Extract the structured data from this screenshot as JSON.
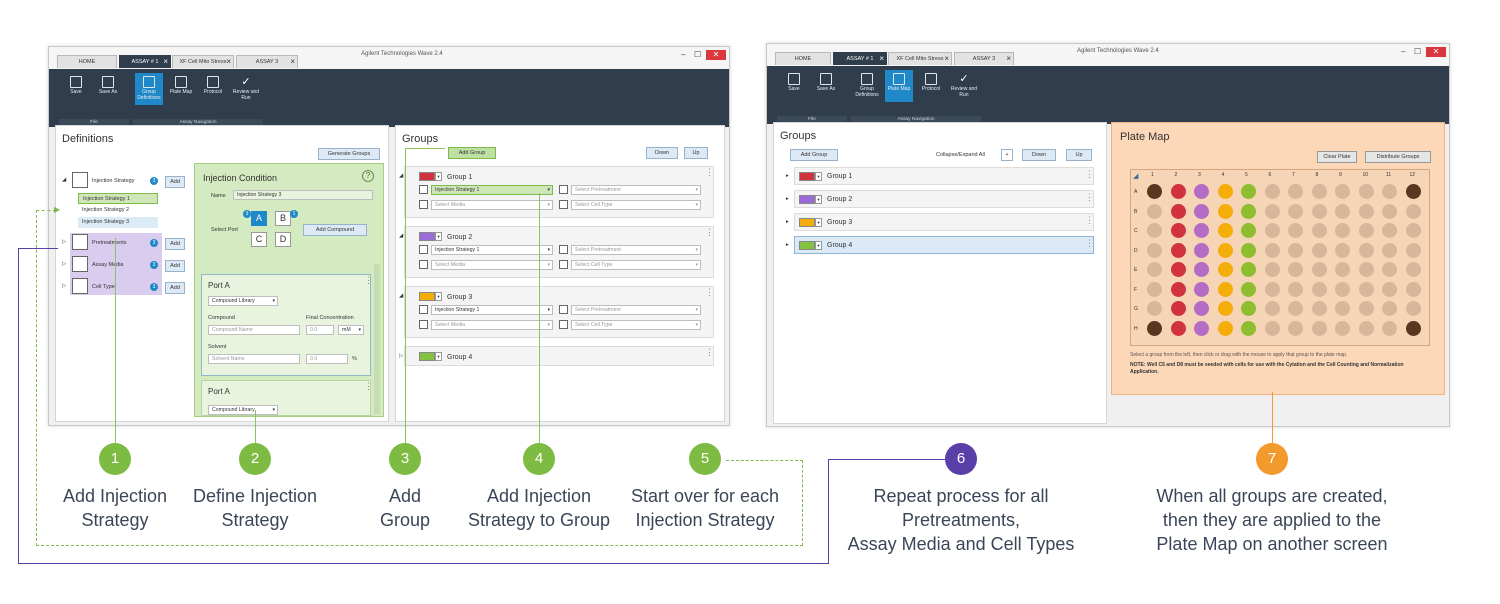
{
  "app_title": "Agilent Technologies Wave 2.4",
  "tabs_left": [
    {
      "label": "HOME"
    },
    {
      "label": "ASSAY # 1"
    },
    {
      "label": "XF Cell Mito Stress"
    },
    {
      "label": "ASSAY 3"
    }
  ],
  "tabs_right": [
    {
      "label": "HOME"
    },
    {
      "label": "ASSAY # 1"
    },
    {
      "label": "XF Cell Mito Stress"
    },
    {
      "label": "ASSAY 3"
    }
  ],
  "window_controls": {
    "minimize": "–",
    "maximize": "☐",
    "close": "✕"
  },
  "ribbon": {
    "save": "Save",
    "save_as": "Save As",
    "group_definitions": "Group Definitions",
    "plate_map": "Plate Map",
    "protocol": "Protocol",
    "review_and_run": "Review and Run",
    "file_section": "File",
    "assay_nav_section": "Assay Navigation"
  },
  "definitions": {
    "title": "Definitions",
    "generate_groups": "Generate Groups",
    "injection_strategy": "Injection Strategy",
    "injection_badge": "3",
    "add": "Add",
    "strategies": [
      "Injection Strategy 1",
      "Injection Strategy 2",
      "Injection Strategy 3"
    ],
    "pretreatments": "Pretreatments",
    "pretreatments_badge": "3",
    "assay_media": "Assay Media",
    "assay_media_badge": "3",
    "cell_type": "Cell Type",
    "cell_type_badge": "3"
  },
  "injection_condition": {
    "title": "Injection Condition",
    "help": "?",
    "name_label": "Name",
    "name_value": "Injection Strategy 3",
    "select_port_label": "Select Port",
    "ports": [
      "A",
      "B",
      "C",
      "D"
    ],
    "port_badges": [
      "3",
      "1"
    ],
    "add_compound": "Add Compound",
    "port_a_title": "Port A",
    "compound_library": "Compound Library",
    "compound_label": "Compound",
    "final_concentration_label": "Final Concentration",
    "compound_name_placeholder": "Compound Name",
    "conc_value": "0.0",
    "conc_unit": "mM",
    "solvent_label": "Solvent",
    "solvent_name_placeholder": "Solvent Name",
    "solvent_value": "0.0",
    "percent": "%",
    "port_a2_title": "Port A",
    "compound_library2": "Compound Library"
  },
  "groups_left": {
    "title": "Groups",
    "add_group": "Add Group",
    "down": "Down",
    "up": "Up",
    "groups": [
      {
        "name": "Group 1",
        "color": "#d0333f",
        "strategy": "Injection Strategy 1",
        "pretreatment": "Select Pretreatment",
        "media": "Select Media",
        "cell_type": "Select Cell Type"
      },
      {
        "name": "Group 2",
        "color": "#9b6cd9",
        "strategy": "Injection Strategy 1",
        "pretreatment": "Select Pretreatment",
        "media": "Select Media",
        "cell_type": "Select Cell Type"
      },
      {
        "name": "Group 3",
        "color": "#f5ad0a",
        "strategy": "Injection Strategy 1",
        "pretreatment": "Select Pretreatment",
        "media": "Select Media",
        "cell_type": "Select Cell Type"
      },
      {
        "name": "Group 4",
        "color": "#83c341"
      }
    ]
  },
  "groups_right": {
    "title": "Groups",
    "add_group": "Add Group",
    "collapse_expand": "Collapse/Expand All",
    "plus": "+",
    "down": "Down",
    "up": "Up",
    "groups": [
      {
        "name": "Group 1",
        "color": "#d0333f"
      },
      {
        "name": "Group 2",
        "color": "#9b6cd9"
      },
      {
        "name": "Group 3",
        "color": "#f5ad0a"
      },
      {
        "name": "Group 4",
        "color": "#83c341"
      }
    ]
  },
  "plate_map": {
    "title": "Plate Map",
    "clear_plate": "Clear Plate",
    "distribute_groups": "Distribute Groups",
    "columns": [
      "1",
      "2",
      "3",
      "4",
      "5",
      "6",
      "7",
      "8",
      "9",
      "10",
      "11",
      "12"
    ],
    "rows": [
      "A",
      "B",
      "C",
      "D",
      "E",
      "F",
      "G",
      "H"
    ],
    "instruction": "Select a group from the left, then click or drag with the mouse to apply that group to the plate map.",
    "note": "NOTE: Well C5 and D8 must be seeded with cells for use with the Cytation and the Cell Counting and Normalization Application.",
    "colors": {
      "empty": "#d7b79c",
      "bg": "#5a3620",
      "g1": "#d0333f",
      "g2": "#b46cc4",
      "g3": "#f5ad0a",
      "g4": "#8ebd2f"
    }
  },
  "steps": [
    {
      "num": "1",
      "line1": "Add Injection",
      "line2": "Strategy",
      "color": "#7dbb42"
    },
    {
      "num": "2",
      "line1": "Define Injection",
      "line2": "Strategy",
      "color": "#7dbb42"
    },
    {
      "num": "3",
      "line1": "Add",
      "line2": "Group",
      "color": "#7dbb42"
    },
    {
      "num": "4",
      "line1": "Add Injection",
      "line2": "Strategy to Group",
      "color": "#7dbb42"
    },
    {
      "num": "5",
      "line1": "Start over for each",
      "line2": "Injection Strategy",
      "color": "#7dbb42"
    },
    {
      "num": "6",
      "line1": "Repeat process for all",
      "line2": "Pretreatments,",
      "line3": "Assay Media and Cell Types",
      "color": "#5b3fa8"
    },
    {
      "num": "7",
      "line1": "When all groups are created,",
      "line2": "then they are applied to the",
      "line3": "Plate Map on another screen",
      "color": "#f39a2d"
    }
  ]
}
